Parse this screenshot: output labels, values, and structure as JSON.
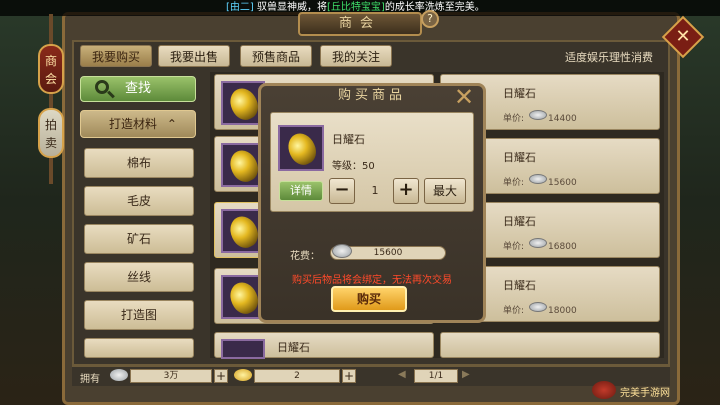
{
  "announcement": {
    "channel": "[由二]",
    "text1": " 驭兽显神威，将",
    "item": "[丘比特宝宝]",
    "text2": "的成长率洗炼至完美。"
  },
  "title": "商会",
  "help_icon": "?",
  "side_tabs": [
    {
      "label": "商会",
      "active": true
    },
    {
      "label": "拍卖",
      "active": false
    }
  ],
  "close_icon": "✕",
  "tabs": [
    {
      "label": "我要购买",
      "active": true
    },
    {
      "label": "我要出售",
      "active": false
    },
    {
      "label": "预售商品",
      "active": false
    },
    {
      "label": "我的关注",
      "active": false
    }
  ],
  "hint": "适度娱乐理性消费",
  "search_label": "查找",
  "category": {
    "label": "打造材料",
    "arrow": "⌃"
  },
  "subcategories": [
    "棉布",
    "毛皮",
    "矿石",
    "丝线",
    "打造图"
  ],
  "items": [
    {
      "name": "日耀石",
      "price_label": "单价:",
      "price": "14400"
    },
    {
      "name": "日耀石",
      "price_label": "单价:",
      "price": "15600"
    },
    {
      "name": "日耀石",
      "price_label": "单价:",
      "price": "16800"
    },
    {
      "name": "日耀石",
      "price_label": "单价:",
      "price": "18000"
    },
    {
      "name": "日耀石"
    }
  ],
  "bottom": {
    "own_label": "拥有",
    "silver": "3万",
    "gold": "2",
    "plus": "+",
    "page": "1/1"
  },
  "modal": {
    "title": "购买商品",
    "item_name": "日耀石",
    "level_label": "等级：",
    "level": "50",
    "detail_label": "详情",
    "minus": "−",
    "quantity": "1",
    "plus": "+",
    "max_label": "最大",
    "cost_label": "花费：",
    "cost": "15600",
    "warning": "购买后物品将会绑定，无法再次交易",
    "buy_label": "购买"
  },
  "watermark": "完美手游网",
  "colors": {
    "accent_gold": "#e09a1a",
    "warning": "#ff4a2a",
    "green_button": "#5d8a3a"
  }
}
